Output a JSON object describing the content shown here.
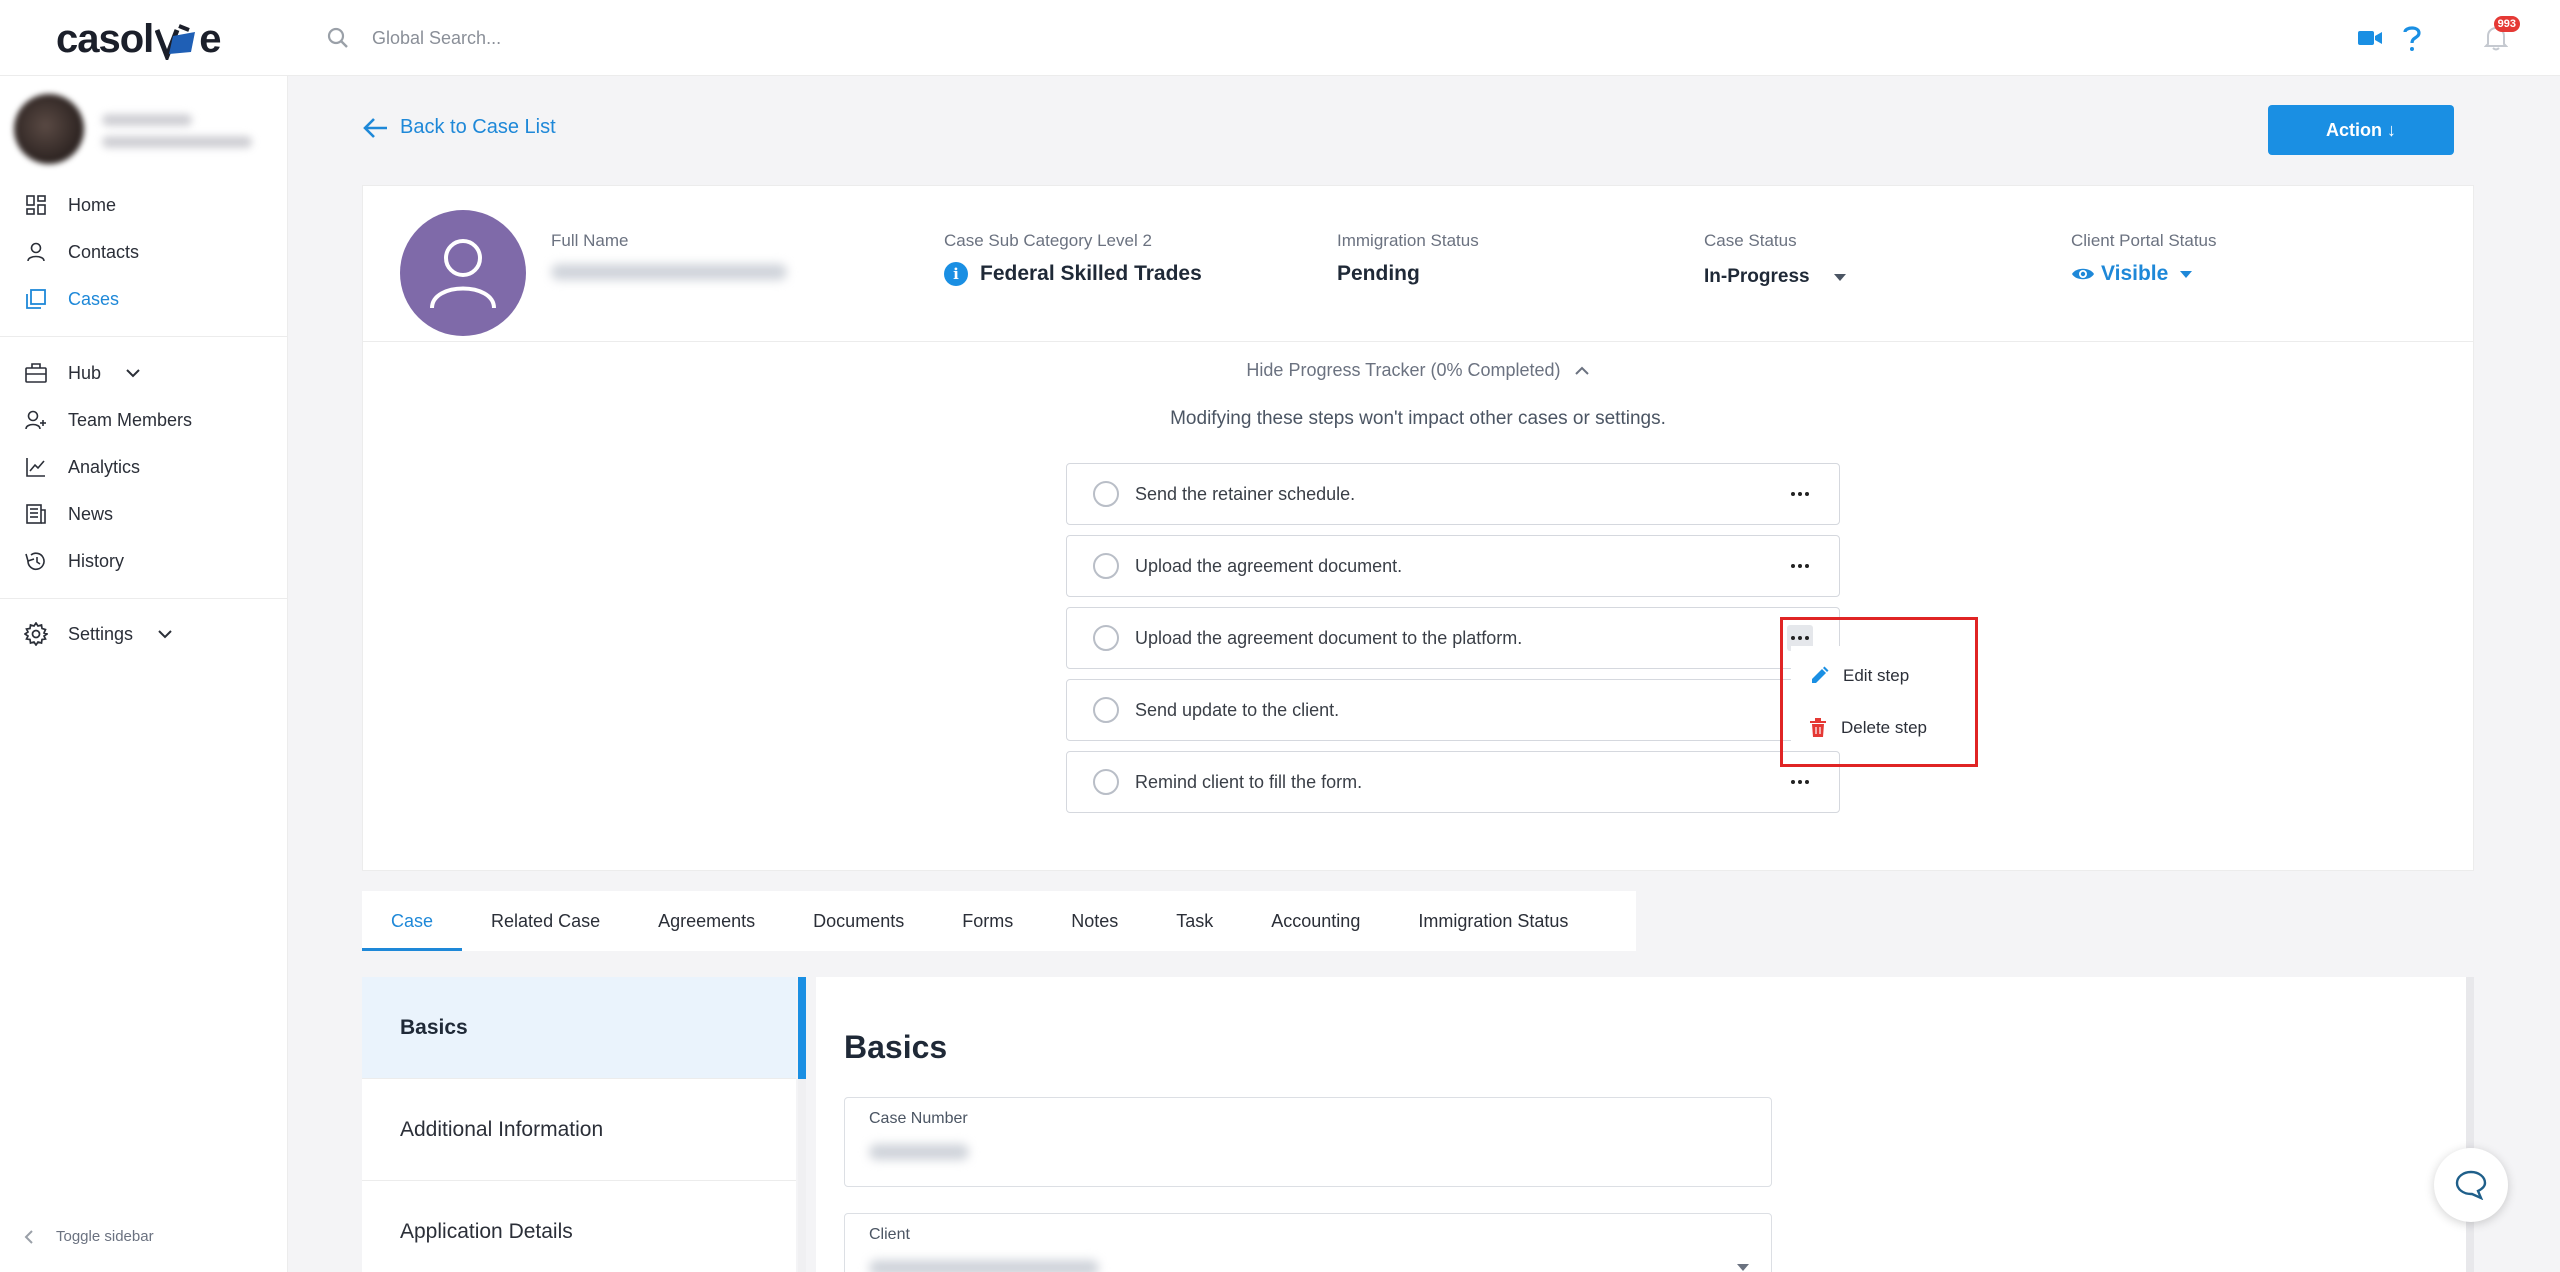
{
  "brand": {
    "name_left": "casol",
    "name_right": "e"
  },
  "search": {
    "placeholder": "Global Search..."
  },
  "header": {
    "notification_count": "993"
  },
  "sidebar": {
    "items": [
      {
        "label": "Home"
      },
      {
        "label": "Contacts"
      },
      {
        "label": "Cases"
      },
      {
        "label": "Hub"
      },
      {
        "label": "Team Members"
      },
      {
        "label": "Analytics"
      },
      {
        "label": "News"
      },
      {
        "label": "History"
      },
      {
        "label": "Settings"
      }
    ],
    "toggle_label": "Toggle sidebar"
  },
  "main": {
    "back_label": "Back to Case List",
    "action_label": "Action ↓"
  },
  "case": {
    "full_name_label": "Full Name",
    "sub_category_label": "Case Sub Category Level 2",
    "sub_category_value": "Federal Skilled Trades",
    "immigration_label": "Immigration Status",
    "immigration_value": "Pending",
    "case_status_label": "Case Status",
    "case_status_value": "In-Progress",
    "portal_label": "Client Portal Status",
    "portal_value": "Visible"
  },
  "tracker": {
    "toggle_label": "Hide Progress Tracker (0% Completed)",
    "note": "Modifying these steps won't impact other cases or settings.",
    "steps": [
      {
        "text": "Send the retainer schedule."
      },
      {
        "text": "Upload the agreement document."
      },
      {
        "text": "Upload the agreement document to the platform."
      },
      {
        "text": "Send update to the client."
      },
      {
        "text": "Remind client to fill the form."
      }
    ],
    "menu": {
      "edit_label": "Edit step",
      "delete_label": "Delete step"
    }
  },
  "tabs": [
    {
      "label": "Case"
    },
    {
      "label": "Related Case"
    },
    {
      "label": "Agreements"
    },
    {
      "label": "Documents"
    },
    {
      "label": "Forms"
    },
    {
      "label": "Notes"
    },
    {
      "label": "Task"
    },
    {
      "label": "Accounting"
    },
    {
      "label": "Immigration Status"
    }
  ],
  "sub_nav": [
    {
      "label": "Basics"
    },
    {
      "label": "Additional Information"
    },
    {
      "label": "Application Details"
    }
  ],
  "basics": {
    "title": "Basics",
    "case_number_label": "Case Number",
    "client_label": "Client"
  },
  "colors": {
    "accent": "#1a8fe3",
    "avatar": "#7f6aa9",
    "danger": "#e53935"
  }
}
